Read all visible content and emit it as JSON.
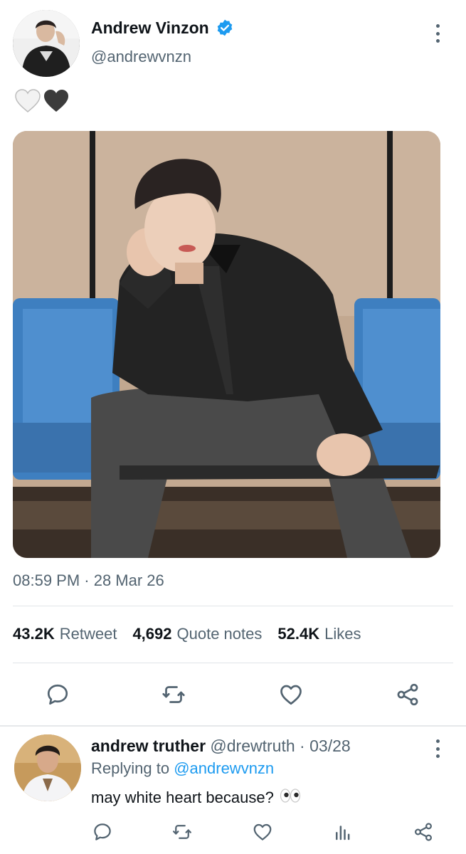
{
  "tweet": {
    "author_name": "Andrew Vinzon",
    "author_handle": "@andrewvnzn",
    "verified": true,
    "text_emojis": [
      "white-heart",
      "black-heart"
    ],
    "timestamp": "08:59 PM · 28 Mar 26"
  },
  "stats": {
    "retweets_count": "43.2K",
    "retweets_label": "Retweet",
    "quotes_count": "4,692",
    "quotes_label": "Quote notes",
    "likes_count": "52.4K",
    "likes_label": "Likes"
  },
  "actions": [
    "reply-icon",
    "retweet-icon",
    "like-icon",
    "share-icon"
  ],
  "reply": {
    "name": "andrew truther",
    "handle": "@drewtruth",
    "separator": "·",
    "date": "03/28",
    "replying_prefix": "Replying to",
    "replying_handle": "@andrewvnzn",
    "text": "may white heart because?",
    "text_emoji": "eyes",
    "actions": [
      "reply-icon",
      "retweet-icon",
      "like-icon",
      "analytics-icon",
      "share-icon"
    ]
  },
  "colors": {
    "text_primary": "#0f1419",
    "text_secondary": "#536471",
    "accent": "#1d9bf0",
    "icon": "#536471",
    "divider": "#e1e4e8"
  }
}
